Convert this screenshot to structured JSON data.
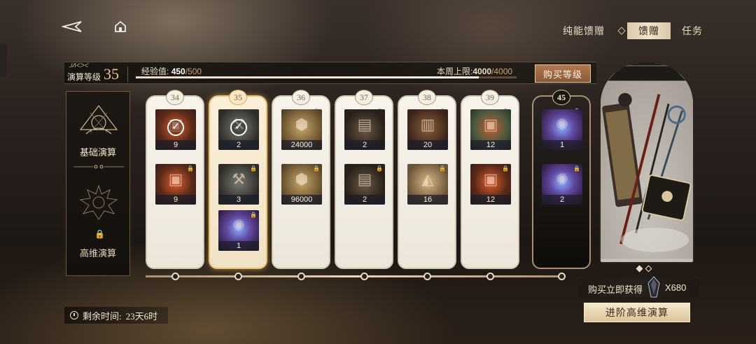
{
  "nav": {
    "back_icon": "back-arrow-icon",
    "home_icon": "home-icon"
  },
  "tabs": [
    {
      "label": "纯能馈赠",
      "active": false
    },
    {
      "label": "馈赠",
      "active": true
    },
    {
      "label": "任务",
      "active": false
    }
  ],
  "level": {
    "small_text": "ᒧᐱᐸᐳᐸ",
    "label": "演算等级",
    "value": "35",
    "exp_label": "经验值:",
    "exp_current": "450",
    "exp_max": "/500",
    "exp_progress": 0.9,
    "weekly_label": "本周上限:",
    "weekly_current": "4000",
    "weekly_max": "/4000",
    "buy_button": "购买等级"
  },
  "left_panel": {
    "basic_title": "基础演算",
    "advanced_title": "高维演算",
    "advanced_locked": true
  },
  "cards": [
    {
      "level": "34",
      "style": "normal",
      "locked": false,
      "items": [
        {
          "qty": "9",
          "art": "bg-box-red",
          "claimed": true
        },
        {
          "qty": "9",
          "art": "bg-box-red",
          "claimed": false,
          "locked": true
        }
      ]
    },
    {
      "level": "35",
      "style": "gold",
      "locked": false,
      "items": [
        {
          "qty": "2",
          "art": "bg-hammer",
          "claimed": true
        },
        {
          "qty": "3",
          "art": "bg-hammer",
          "claimed": false,
          "locked": true
        },
        {
          "qty": "1",
          "art": "bg-orb",
          "claimed": false,
          "locked": true
        }
      ]
    },
    {
      "level": "36",
      "style": "normal",
      "locked": true,
      "items": [
        {
          "qty": "24000",
          "art": "bg-coin",
          "claimed": false
        },
        {
          "qty": "96000",
          "art": "bg-coin",
          "claimed": false,
          "locked": true
        }
      ]
    },
    {
      "level": "37",
      "style": "normal",
      "locked": true,
      "items": [
        {
          "qty": "2",
          "art": "bg-chest",
          "claimed": false
        },
        {
          "qty": "2",
          "art": "bg-chest",
          "claimed": false,
          "locked": true
        }
      ]
    },
    {
      "level": "38",
      "style": "normal",
      "locked": true,
      "items": [
        {
          "qty": "20",
          "art": "bg-book",
          "claimed": false
        },
        {
          "qty": "16",
          "art": "bg-sack",
          "claimed": false,
          "locked": true
        }
      ]
    },
    {
      "level": "39",
      "style": "normal",
      "locked": true,
      "items": [
        {
          "qty": "12",
          "art": "bg-green",
          "claimed": false
        },
        {
          "qty": "12",
          "art": "bg-box-red",
          "claimed": false,
          "locked": true
        }
      ]
    },
    {
      "level": "45",
      "style": "dark",
      "locked": true,
      "items": [
        {
          "qty": "1",
          "art": "bg-orb",
          "claimed": false
        },
        {
          "qty": "2",
          "art": "bg-orb",
          "claimed": false,
          "locked": true
        }
      ]
    }
  ],
  "preview": {
    "buy_get_label": "购买立即获得",
    "buy_get_amount": "X680",
    "advance_button": "进阶高维演算"
  },
  "timer": {
    "label": "剩余时间:",
    "value": "23天6时"
  }
}
